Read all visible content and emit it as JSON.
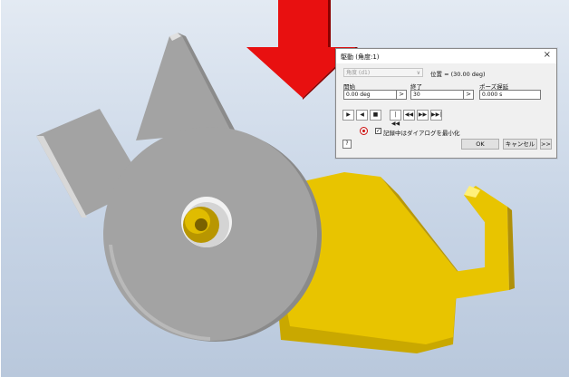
{
  "dialog": {
    "title": "駆動 (角度:1)",
    "close_glyph": "×",
    "combo_value": "角度 (d1)",
    "position_text": "位置 = (30.00 deg)",
    "start_label": "開始",
    "end_label": "終了",
    "pause_label": "ポーズ遅延",
    "start_value": "0.00 deg",
    "end_value": "30",
    "pause_value": "0.000 s",
    "spin_glyph": ">",
    "playback": {
      "play_forward": "▶",
      "play_reverse": "◀",
      "pause": "■",
      "to_start": "|◀◀",
      "step_back": "◀◀",
      "step_forward": "▶▶",
      "to_end": "▶▶|"
    },
    "checkbox_mark": "✓",
    "minimize_label": "記録中はダイアログを最小化",
    "help_glyph": "?",
    "ok_label": "OK",
    "cancel_label": "キャンセル",
    "expand_label": ">>"
  },
  "colors": {
    "arrow": "#ff0000",
    "cat_head": "#a3a3a3",
    "cat_body": "#e6c300",
    "record": "#d01010"
  },
  "icons": {
    "arrow": "down-arrow-icon",
    "record": "record-icon",
    "help": "help-icon"
  }
}
